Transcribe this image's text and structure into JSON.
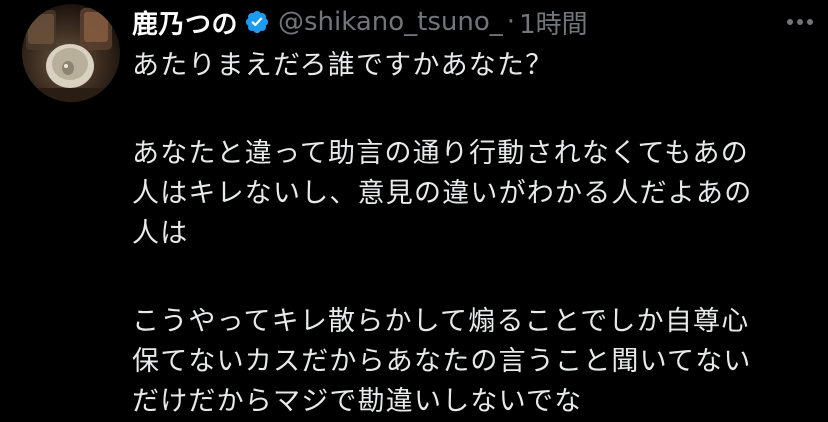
{
  "author": {
    "display_name": "鹿乃つの",
    "handle": "@shikano_tsuno_",
    "separator": "·",
    "timestamp": "1時間",
    "verified": true,
    "verified_color": "#1d9bf0"
  },
  "tweet": {
    "lines": [
      "あたりまえだろ誰ですかあなた？",
      "",
      "あなたと違って助言の通り行動されなくてもあの",
      "人はキレないし、意見の違いがわかる人だよあの",
      "人は",
      "",
      "こうやってキレ散らかして煽ることでしか自尊心",
      "保てないカスだからあなたの言うこと聞いてない",
      "だけだからマジで勘違いしないでな"
    ]
  },
  "icons": {
    "avatar": "avatar-photo",
    "verified": "verified-badge-icon",
    "more": "more-options-icon"
  },
  "colors": {
    "background": "#000000",
    "text": "#e7e9ea",
    "secondary": "#71767b"
  }
}
